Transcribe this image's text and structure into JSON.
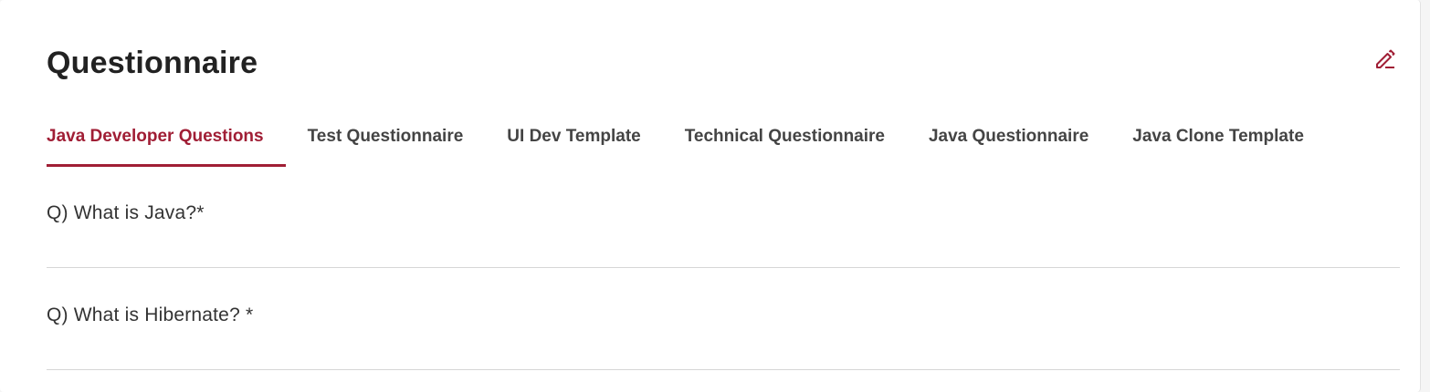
{
  "header": {
    "title": "Questionnaire",
    "edit_icon": "pencil-edit-icon"
  },
  "tabs": [
    {
      "label": "Java Developer Questions",
      "active": true
    },
    {
      "label": "Test Questionnaire",
      "active": false
    },
    {
      "label": "UI Dev Template",
      "active": false
    },
    {
      "label": "Technical Questionnaire",
      "active": false
    },
    {
      "label": "Java Questionnaire",
      "active": false
    },
    {
      "label": "Java Clone Template",
      "active": false
    }
  ],
  "questions": [
    {
      "text": "Q) What is Java?*"
    },
    {
      "text": "Q) What is Hibernate? *"
    }
  ],
  "colors": {
    "accent": "#a01e35",
    "text": "#222222",
    "divider": "#d6d6d6"
  }
}
